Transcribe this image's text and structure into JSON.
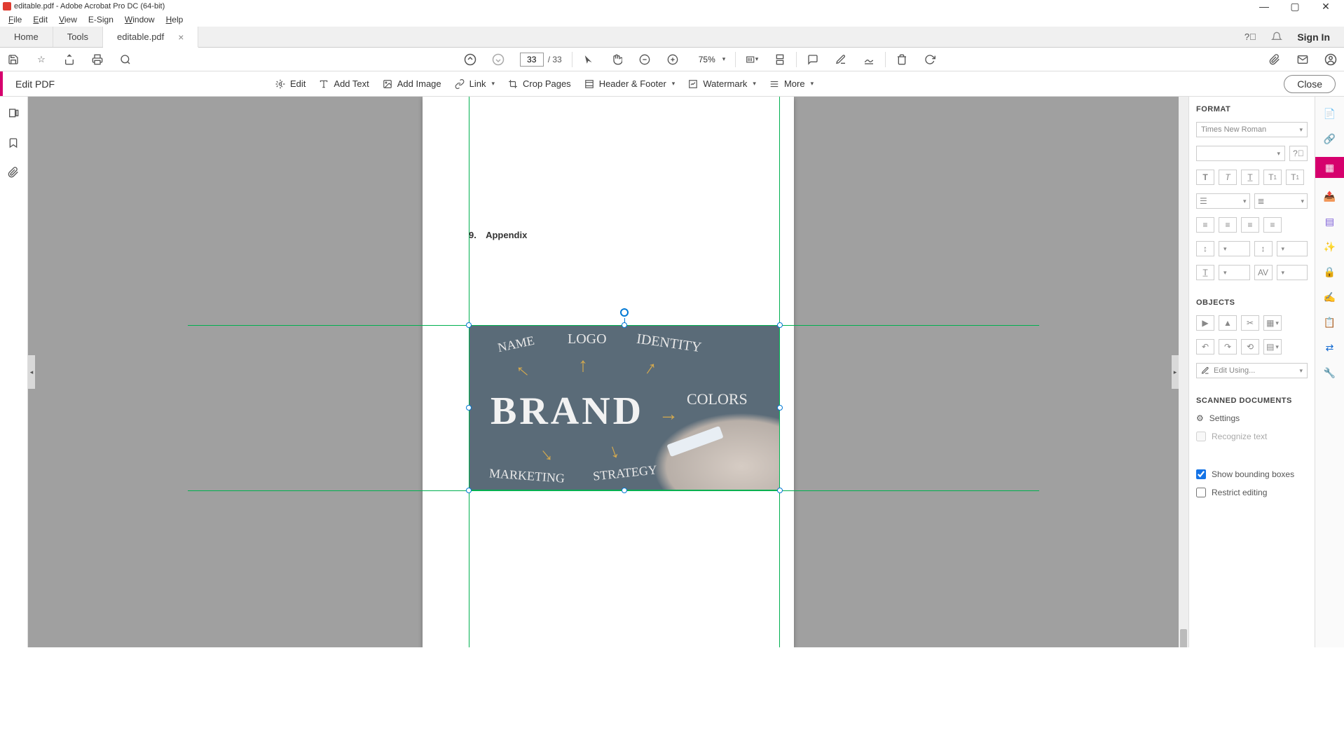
{
  "titlebar": {
    "title": "editable.pdf - Adobe Acrobat Pro DC (64-bit)"
  },
  "menubar": {
    "file": "File",
    "edit": "Edit",
    "view": "View",
    "esign": "E-Sign",
    "window": "Window",
    "help": "Help"
  },
  "tabs": {
    "home": "Home",
    "tools": "Tools",
    "doc": "editable.pdf",
    "signin": "Sign In"
  },
  "quickbar": {
    "page_current": "33",
    "page_total": "/ 33",
    "zoom": "75%"
  },
  "editbar": {
    "title": "Edit PDF",
    "edit": "Edit",
    "add_text": "Add Text",
    "add_image": "Add Image",
    "link": "Link",
    "crop": "Crop Pages",
    "header": "Header & Footer",
    "watermark": "Watermark",
    "more": "More",
    "close": "Close"
  },
  "panel": {
    "format_hdr": "FORMAT",
    "font": "Times New Roman",
    "objects_hdr": "OBJECTS",
    "edit_using": "Edit Using...",
    "scanned_hdr": "SCANNED DOCUMENTS",
    "settings": "Settings",
    "recognize": "Recognize text",
    "show_bb": "Show bounding boxes",
    "restrict": "Restrict editing"
  },
  "document": {
    "heading_num": "9.",
    "heading_text": "Appendix",
    "image_words": {
      "brand": "BRAND",
      "name": "NAME",
      "logo": "LOGO",
      "identity": "IDENTITY",
      "colors": "COLORS",
      "marketing": "MARKETING",
      "strategy": "STRATEGY"
    }
  }
}
